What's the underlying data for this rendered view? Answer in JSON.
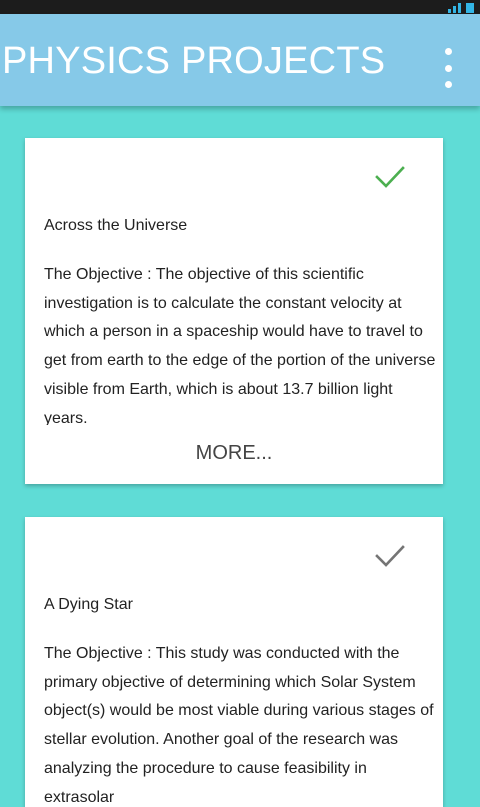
{
  "toolbar": {
    "title": "PHYSICS PROJECTS"
  },
  "projects": [
    {
      "title": "Across the Universe",
      "description": "The Objective : The objective of this scientific investigation is to calculate the constant velocity at which a person in a spaceship would have to travel to get from earth to the edge of the portion of the universe visible from Earth, which is about 13.7 billion light years.",
      "more_label": "MORE...",
      "check_icon": "check-icon",
      "check_color": "#4caf50"
    },
    {
      "title": "A Dying Star",
      "description": "The Objective : This study was conducted with the primary objective of determining which Solar System object(s) would be most viable during various stages of stellar evolution. Another goal of the research was analyzing the procedure to cause feasibility in extrasolar",
      "check_icon": "check-icon",
      "check_color": "#757575"
    }
  ],
  "colors": {
    "background": "#5fdcd6",
    "toolbar": "#86c9e8",
    "status_bar": "#1c1c1c"
  }
}
